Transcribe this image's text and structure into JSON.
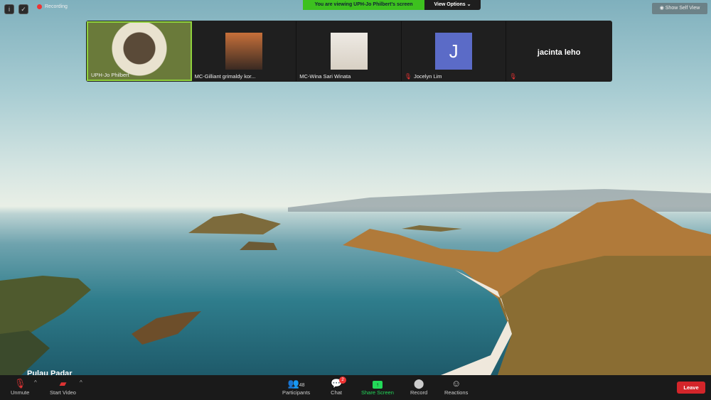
{
  "top": {
    "recording": "Recording",
    "banner": "You are viewing UPH-Jo Philbert's screen",
    "view_options": "View Options ⌄",
    "show_self_view": "Show Self View"
  },
  "participants": [
    {
      "name": "UPH-Jo Philbert",
      "muted": false,
      "active": true
    },
    {
      "name": "MC-Gilliant grimaldy kor...",
      "muted": false
    },
    {
      "name": "MC-Wina Sari Winata",
      "muted": false
    },
    {
      "name": "Jocelyn Lim",
      "muted": true,
      "initial": "J",
      "avatar_color": "#5b6bc7"
    },
    {
      "name": "jacinta leho",
      "muted": true,
      "display": "name-only"
    }
  ],
  "shared_screen": {
    "caption": "Pulau Padar"
  },
  "toolbar": {
    "unmute": "Unmute",
    "start_video": "Start Video",
    "participants": "Participants",
    "participant_count": "48",
    "chat": "Chat",
    "chat_badge": "2",
    "share_screen": "Share Screen",
    "record": "Record",
    "reactions": "Reactions",
    "leave": "Leave"
  },
  "colors": {
    "banner": "#3dc11f",
    "share": "#23d959",
    "leave": "#d3252a",
    "active_border": "#8fd13c"
  }
}
